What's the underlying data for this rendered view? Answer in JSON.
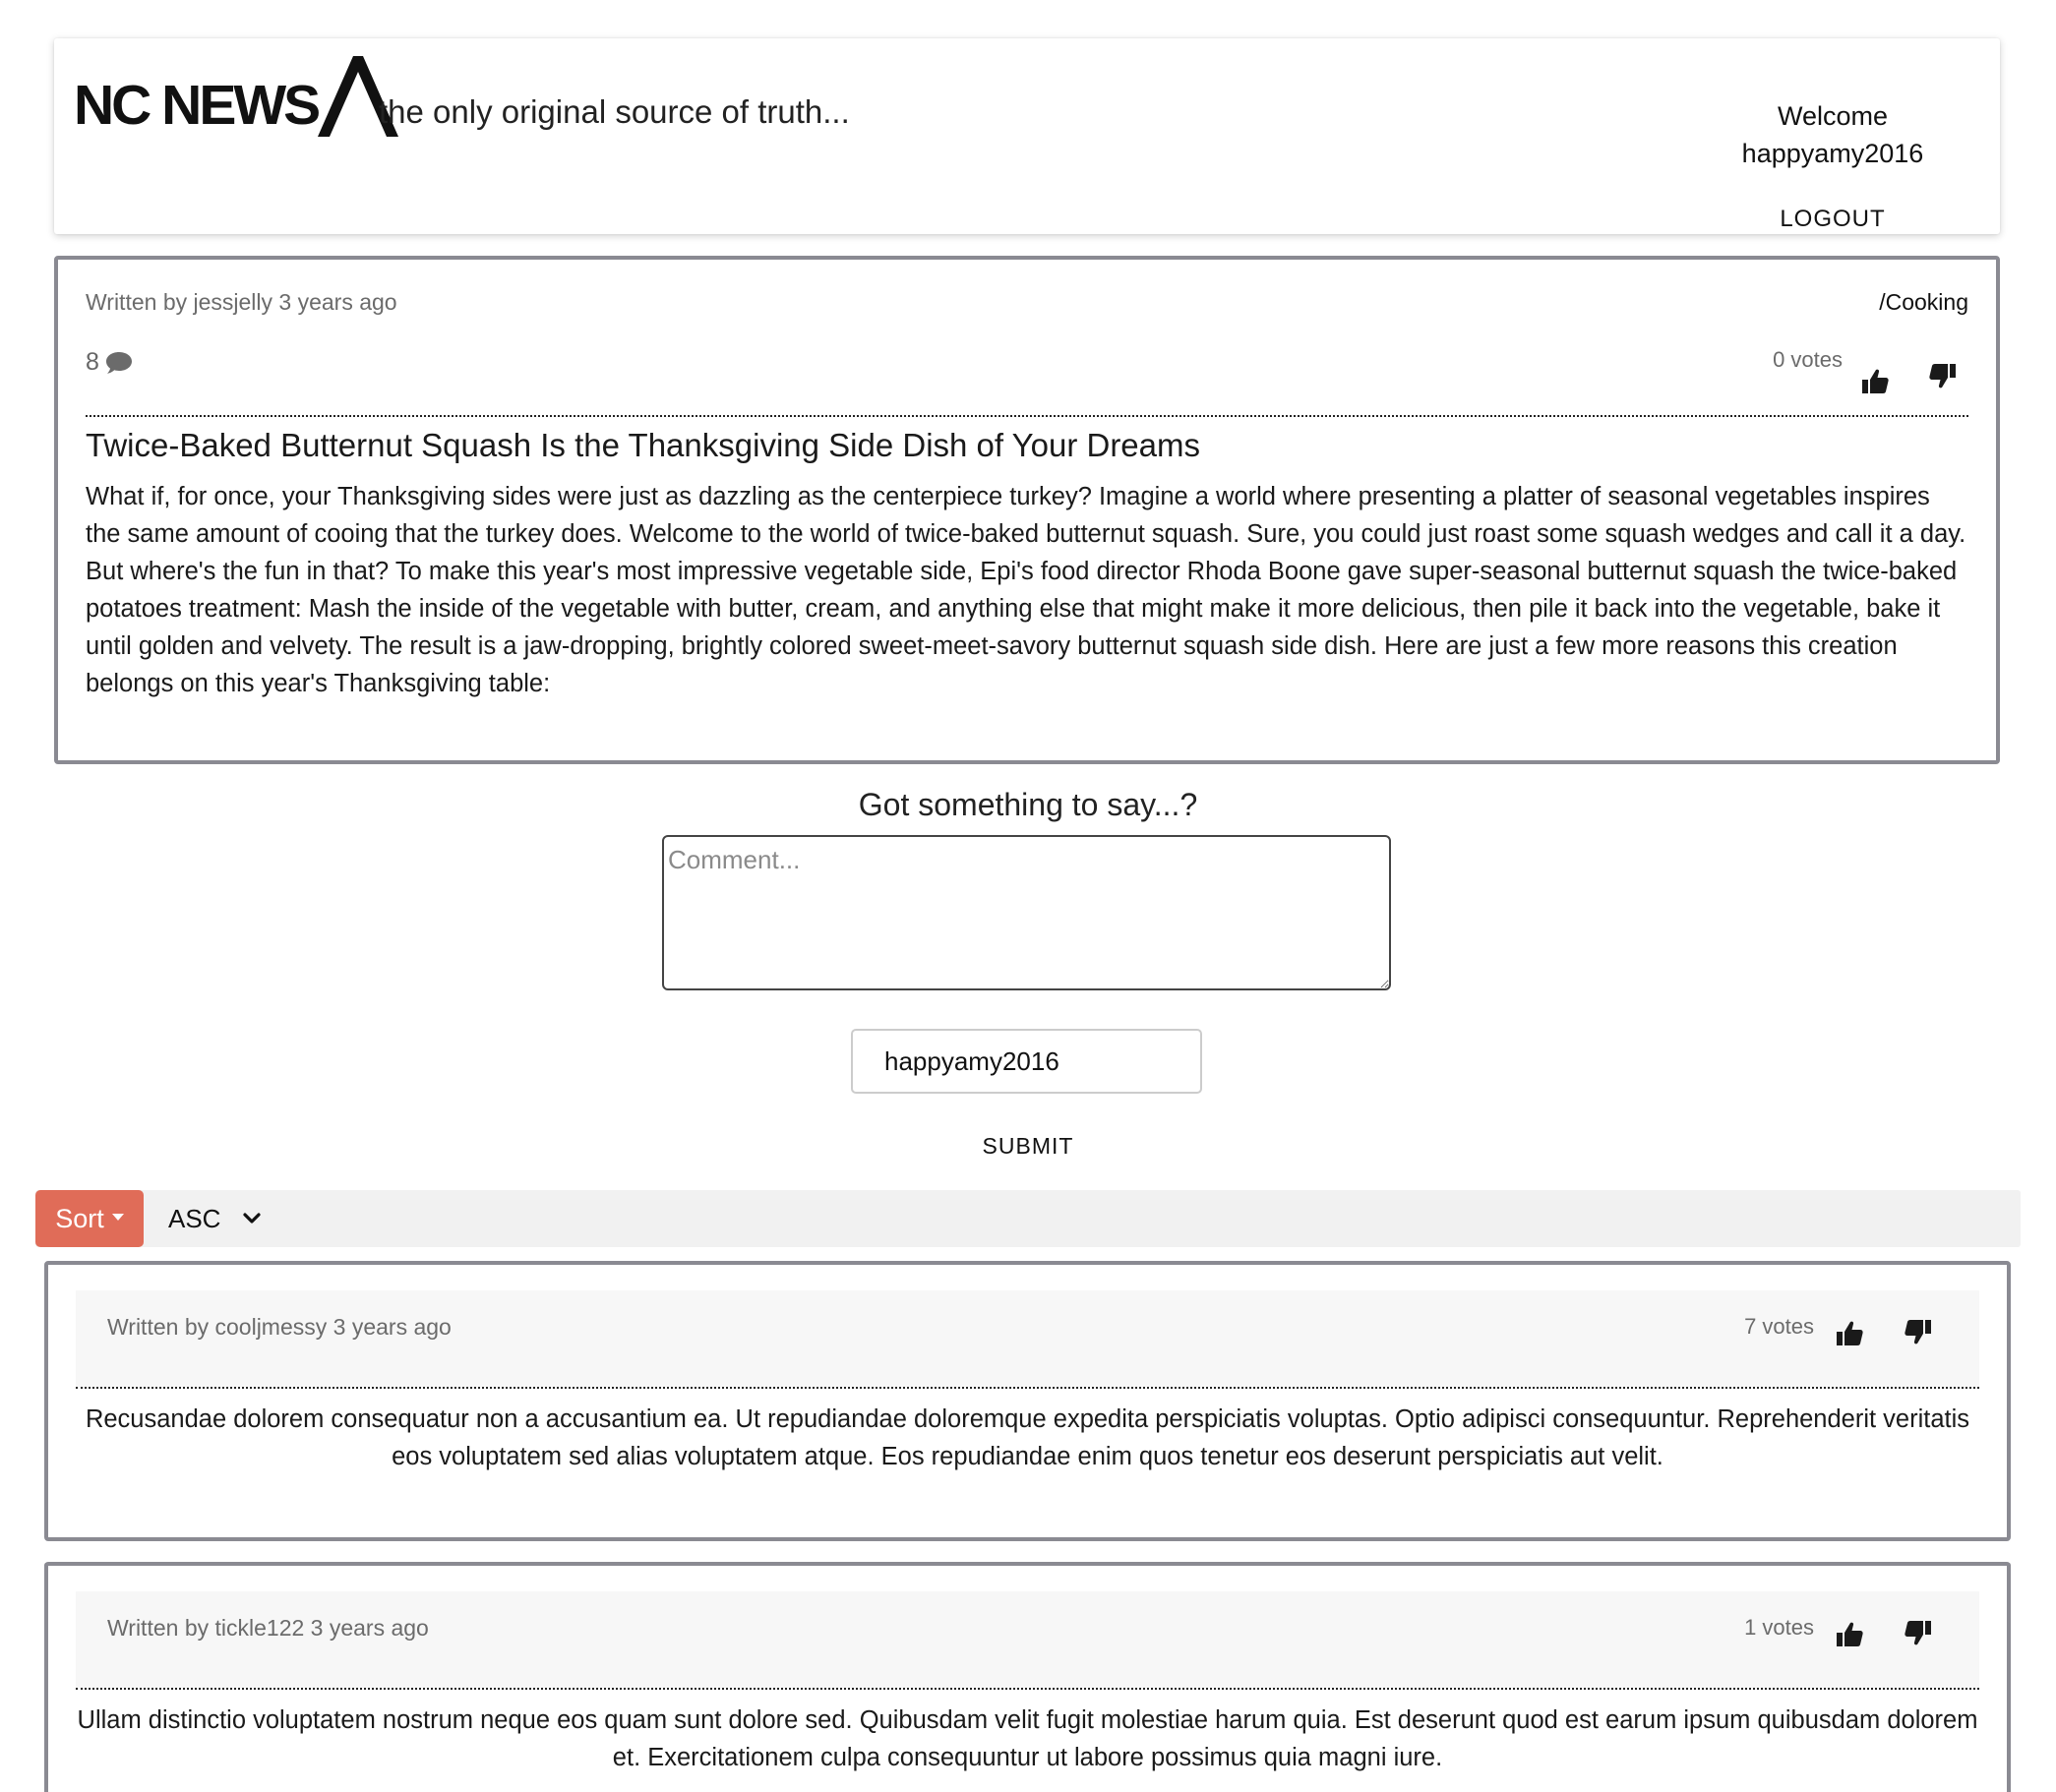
{
  "header": {
    "logo_text": "NC NEWS",
    "tagline": "the only original source of truth...",
    "welcome_label": "Welcome",
    "username": "happyamy2016",
    "logout_label": "LOGOUT"
  },
  "article": {
    "author_meta": "Written by jessjelly 3 years ago",
    "topic": "/Cooking",
    "comment_count": "8",
    "votes": "0 votes",
    "title": "Twice-Baked Butternut Squash Is the Thanksgiving Side Dish of Your Dreams",
    "body": "What if, for once, your Thanksgiving sides were just as dazzling as the centerpiece turkey? Imagine a world where presenting a platter of seasonal vegetables inspires the same amount of cooing that the turkey does. Welcome to the world of twice-baked butternut squash. Sure, you could just roast some squash wedges and call it a day. But where's the fun in that? To make this year's most impressive vegetable side, Epi's food director Rhoda Boone gave super-seasonal butternut squash the twice-baked potatoes treatment: Mash the inside of the vegetable with butter, cream, and anything else that might make it more delicious, then pile it back into the vegetable, bake it until golden and velvety. The result is a jaw-dropping, brightly colored sweet-meet-savory butternut squash side dish. Here are just a few more reasons this creation belongs on this year's Thanksgiving table:"
  },
  "comment_form": {
    "heading": "Got something to say...?",
    "comment_placeholder": "Comment...",
    "username_value": "happyamy2016",
    "submit_label": "SUBMIT"
  },
  "sort": {
    "button_label": "Sort",
    "order_value": "ASC"
  },
  "comments": [
    {
      "author_meta": "Written by cooljmessy 3 years ago",
      "votes": "7 votes",
      "body": "Recusandae dolorem consequatur non a accusantium ea. Ut repudiandae doloremque expedita perspiciatis voluptas. Optio adipisci consequuntur. Reprehenderit veritatis eos voluptatem sed alias voluptatem atque. Eos repudiandae enim quos tenetur eos deserunt perspiciatis aut velit."
    },
    {
      "author_meta": "Written by tickle122 3 years ago",
      "votes": "1 votes",
      "body": "Ullam distinctio voluptatem nostrum neque eos quam sunt dolore sed. Quibusdam velit fugit molestiae harum quia. Est deserunt quod est earum ipsum quibusdam dolorem et. Exercitationem culpa consequuntur ut labore possimus quia magni iure."
    }
  ],
  "icons": {
    "comment": "speech-bubble-icon",
    "upvote": "thumbs-up-icon",
    "downvote": "thumbs-down-icon",
    "dropdown": "chevron-down-icon"
  },
  "colors": {
    "sort_button": "#e06c58",
    "card_border": "#8a8a92",
    "meta_text": "#6b6b6b"
  }
}
